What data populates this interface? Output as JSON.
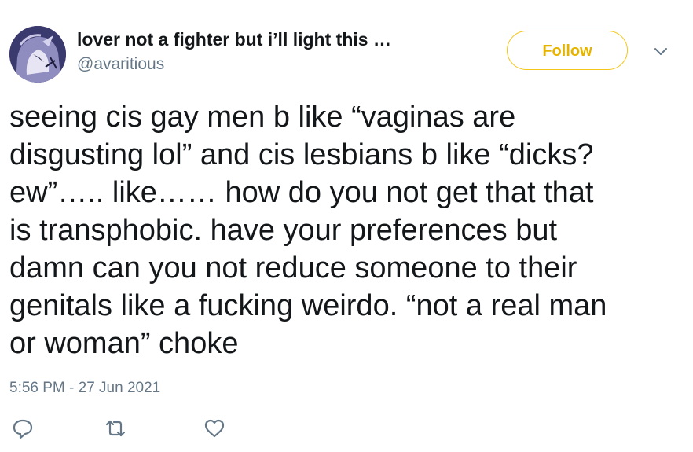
{
  "user": {
    "display_name": "lover not a fighter but i’ll light this …",
    "handle": "@avaritious",
    "avatar_icon": "profile-avatar"
  },
  "header": {
    "follow_label": "Follow",
    "more_icon": "chevron-down-icon",
    "accent_color": "#f5c518"
  },
  "tweet": {
    "text": "seeing cis gay men b like “vaginas are\ndisgusting lol” and cis lesbians b like “dicks?\new”….. like…… how do you not get that that\nis transphobic. have your preferences but\ndamn can you not reduce someone to their\ngenitals like a fucking weirdo. “not a real man\nor woman” choke",
    "timestamp": "5:56 PM - 27 Jun 2021"
  },
  "actions": [
    {
      "name": "reply",
      "icon": "reply-icon"
    },
    {
      "name": "retweet",
      "icon": "retweet-icon"
    },
    {
      "name": "like",
      "icon": "heart-icon"
    }
  ]
}
